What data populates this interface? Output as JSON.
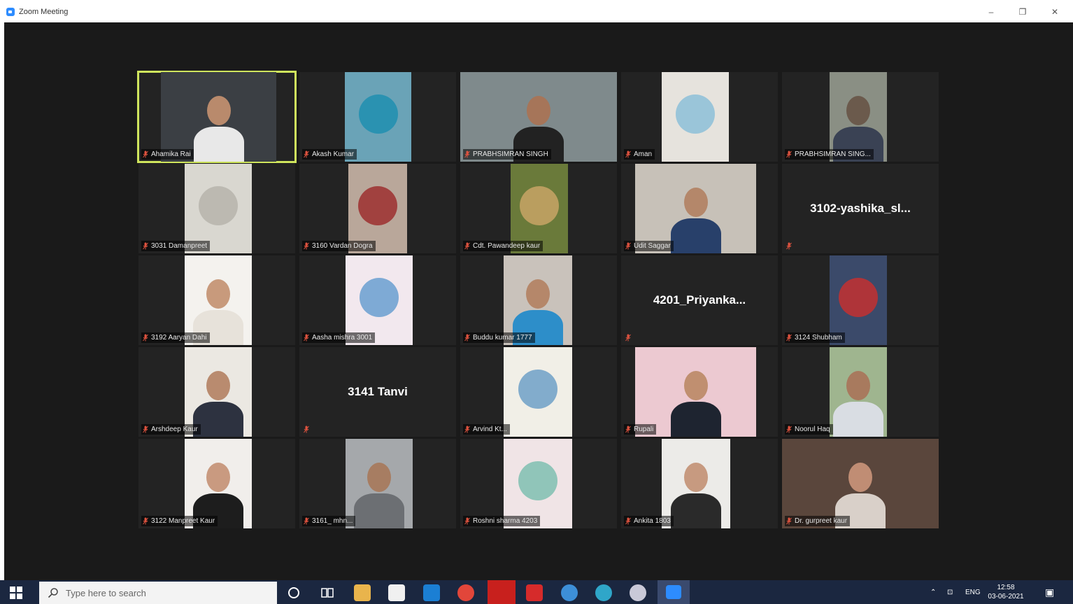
{
  "window": {
    "title": "Zoom Meeting",
    "controls": {
      "minimize": "–",
      "restore": "❐",
      "close": "✕"
    }
  },
  "participants": [
    {
      "name": "Ahamika Rai",
      "type": "video",
      "active_speaker": true
    },
    {
      "name": "Akash Kumar",
      "type": "video"
    },
    {
      "name": "PRABHSIMRAN SINGH",
      "type": "video"
    },
    {
      "name": "Aman",
      "type": "video"
    },
    {
      "name": "PRABHSIMRAN SING...",
      "type": "video"
    },
    {
      "name": "3031 Damanpreet",
      "type": "video"
    },
    {
      "name": "3160 Vardan Dogra",
      "type": "video"
    },
    {
      "name": "Cdt. Pawandeep kaur",
      "type": "video"
    },
    {
      "name": "Udit Saggar",
      "type": "video"
    },
    {
      "name": "3102-yashika_sl...",
      "type": "name_only",
      "label": ""
    },
    {
      "name": "3192 Aaryan Dahi",
      "type": "video"
    },
    {
      "name": "Aasha mishra 3001",
      "type": "video"
    },
    {
      "name": "Buddu kumar 1777",
      "type": "video"
    },
    {
      "name": "4201_Priyanka...",
      "type": "name_only",
      "label": ""
    },
    {
      "name": "3124 Shubham",
      "type": "video"
    },
    {
      "name": "Arshdeep Kaur",
      "type": "video"
    },
    {
      "name": "3141 Tanvi",
      "type": "name_only",
      "label": ""
    },
    {
      "name": "Arvind Kt...",
      "type": "video"
    },
    {
      "name": "Rupali",
      "type": "video"
    },
    {
      "name": "Noorul Haq",
      "type": "video"
    },
    {
      "name": "3122 Manpreet Kaur",
      "type": "video"
    },
    {
      "name": "3161_ mhn...",
      "type": "video"
    },
    {
      "name": "Roshni sharma 4203",
      "type": "video"
    },
    {
      "name": "Ankita 1803",
      "type": "video"
    },
    {
      "name": "Dr. gurpreet kaur",
      "type": "video",
      "muted_icon": false
    }
  ],
  "taskbar": {
    "search_placeholder": "Type here to search",
    "language": "ENG",
    "time": "12:58",
    "date": "03-06-2021"
  },
  "colors": {
    "meeting_bg": "#1a1a1a",
    "tile_bg": "#232323",
    "active_speaker_border": "#cfe55d",
    "muted_mic": "#e0533f",
    "taskbar_bg": "#1b2740"
  }
}
